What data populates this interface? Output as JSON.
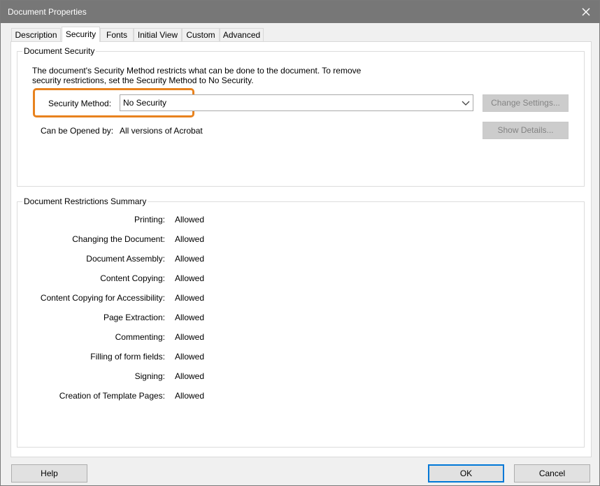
{
  "window": {
    "title": "Document Properties"
  },
  "tabs": [
    "Description",
    "Security",
    "Fonts",
    "Initial View",
    "Custom",
    "Advanced"
  ],
  "active_tab": "Security",
  "document_security": {
    "group_label": "Document Security",
    "description": "The document's Security Method restricts what can be done to the document. To remove security restrictions, set the Security Method to No Security.",
    "security_method_label": "Security Method:",
    "security_method_value": "No Security",
    "change_settings_button": "Change Settings...",
    "opened_by_label": "Can be Opened by:",
    "opened_by_value": "All versions of Acrobat",
    "show_details_button": "Show Details..."
  },
  "restrictions": {
    "group_label": "Document Restrictions Summary",
    "items": [
      {
        "label": "Printing:",
        "value": "Allowed"
      },
      {
        "label": "Changing the Document:",
        "value": "Allowed"
      },
      {
        "label": "Document Assembly:",
        "value": "Allowed"
      },
      {
        "label": "Content Copying:",
        "value": "Allowed"
      },
      {
        "label": "Content Copying for Accessibility:",
        "value": "Allowed"
      },
      {
        "label": "Page Extraction:",
        "value": "Allowed"
      },
      {
        "label": "Commenting:",
        "value": "Allowed"
      },
      {
        "label": "Filling of form fields:",
        "value": "Allowed"
      },
      {
        "label": "Signing:",
        "value": "Allowed"
      },
      {
        "label": "Creation of Template Pages:",
        "value": "Allowed"
      }
    ]
  },
  "footer": {
    "help_button": "Help",
    "ok_button": "OK",
    "cancel_button": "Cancel"
  },
  "colors": {
    "titlebar": "#777777",
    "highlight_outline": "#e8821e",
    "default_button_border": "#0078d7"
  },
  "icons": {
    "close": "close-icon",
    "dropdown": "chevron-down-icon"
  }
}
